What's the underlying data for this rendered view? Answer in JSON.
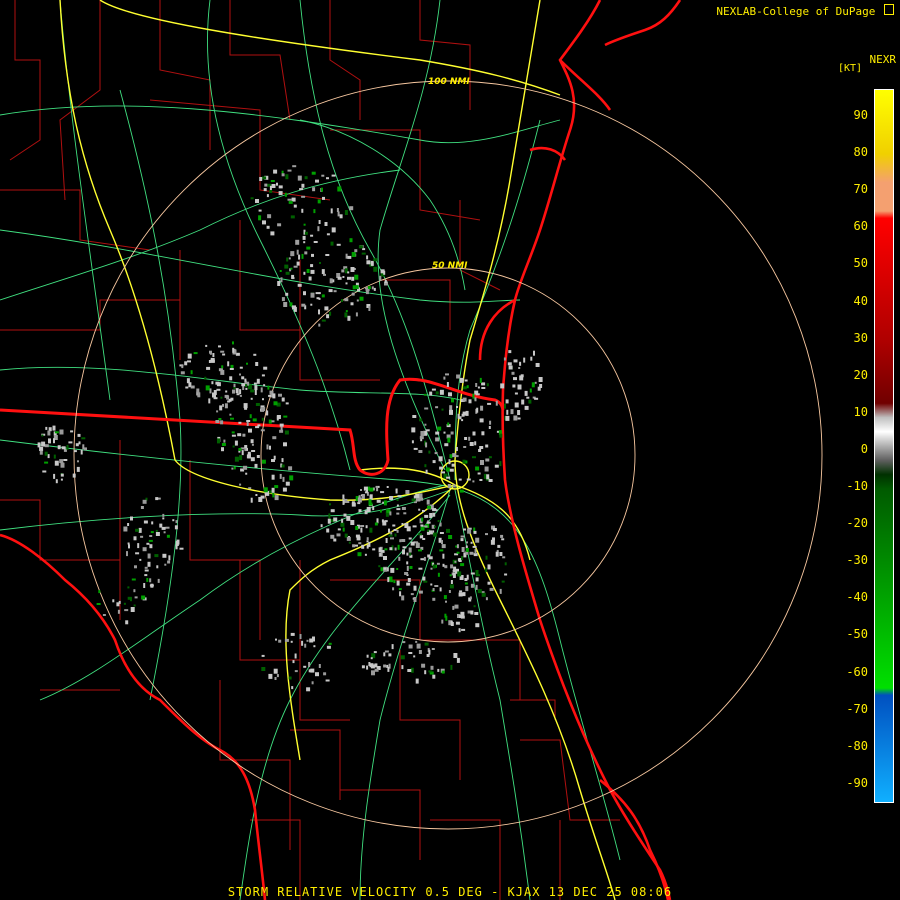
{
  "header": {
    "credit": "NEXLAB-College of DuPage",
    "product": "NEXR"
  },
  "legend": {
    "units": "[KT]",
    "ticks": [
      "90",
      "80",
      "70",
      "60",
      "50",
      "40",
      "30",
      "20",
      "10",
      "0",
      "-10",
      "-20",
      "-30",
      "-40",
      "-50",
      "-60",
      "-70",
      "-80",
      "-90"
    ],
    "colors": {
      "yellow": "#ffff00",
      "peach": "#f4a070",
      "red": "#ff0000",
      "darkred": "#700000",
      "gray": "#c0c0c0",
      "darkgreen": "#005a00",
      "green": "#00e000",
      "blue": "#0050c0",
      "cyan": "#10b0ff"
    }
  },
  "map": {
    "range_rings": [
      {
        "label": "50 NMI"
      },
      {
        "label": "100 NMI"
      }
    ],
    "colors": {
      "coast": "#ff1010",
      "county": "#b01010",
      "highway": "#ffff30",
      "road": "#40e080",
      "ring": "#f8c8a0"
    }
  },
  "footer": {
    "caption": "STORM RELATIVE VELOCITY 0.5 DEG - KJAX 13 DEC 25 08:06"
  }
}
